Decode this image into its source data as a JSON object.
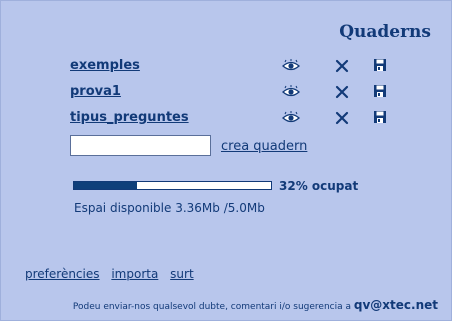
{
  "header": {
    "title": "Quaderns"
  },
  "notebooks": [
    {
      "name": "exemples",
      "view_icon": "eye-icon",
      "delete_icon": "close-icon",
      "save_icon": "floppy-disk-icon"
    },
    {
      "name": "prova1",
      "view_icon": "eye-icon",
      "delete_icon": "close-icon",
      "save_icon": "floppy-disk-icon"
    },
    {
      "name": "tipus_preguntes",
      "view_icon": "eye-icon",
      "delete_icon": "close-icon",
      "save_icon": "floppy-disk-icon"
    }
  ],
  "create": {
    "input_value": "",
    "link_label": "crea quadern"
  },
  "usage": {
    "percent": 32,
    "label": "32% ocupat",
    "space_text": "Espai disponible 3.36Mb /5.0Mb"
  },
  "footer": {
    "links": [
      "preferències",
      "importa",
      "surt"
    ],
    "contact_text": "Podeu enviar-nos qualsevol dubte, comentari i/o sugerencia a",
    "email": "qv@xtec.net"
  },
  "colors": {
    "background": "#b8c6ec",
    "text": "#123a78",
    "bar_fill": "#0f3f7a"
  }
}
